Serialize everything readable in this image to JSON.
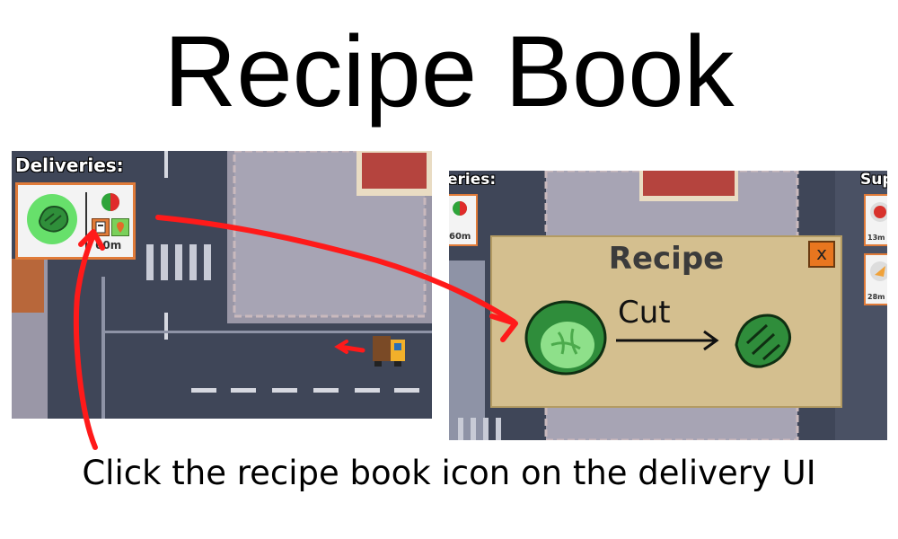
{
  "slide": {
    "title": "Recipe Book",
    "caption": "Click the recipe book icon on the delivery UI"
  },
  "left_screenshot": {
    "hud_title": "Deliveries:",
    "delivery": {
      "item_icon": "lettuce-icon",
      "status_icon": "progress-pie-icon",
      "buttons": [
        "recipe-book-icon",
        "map-pin-icon"
      ],
      "distance": "60m"
    },
    "truck_icon": "delivery-truck-icon"
  },
  "right_screenshot": {
    "hud_left_title": "eries:",
    "hud_right_title": "Sup",
    "delivery_distance": "60m",
    "supply_distances": [
      "13m",
      "28m"
    ],
    "recipe_dialog": {
      "title": "Recipe",
      "close_label": "x",
      "input_icon": "cabbage-icon",
      "step": "Cut",
      "output_icon": "lettuce-icon"
    }
  },
  "colors": {
    "accent_orange": "#e07b39",
    "annotation_red": "#ff1a1a",
    "panel_tan": "#d4bf8f",
    "road": "#3f4658"
  }
}
